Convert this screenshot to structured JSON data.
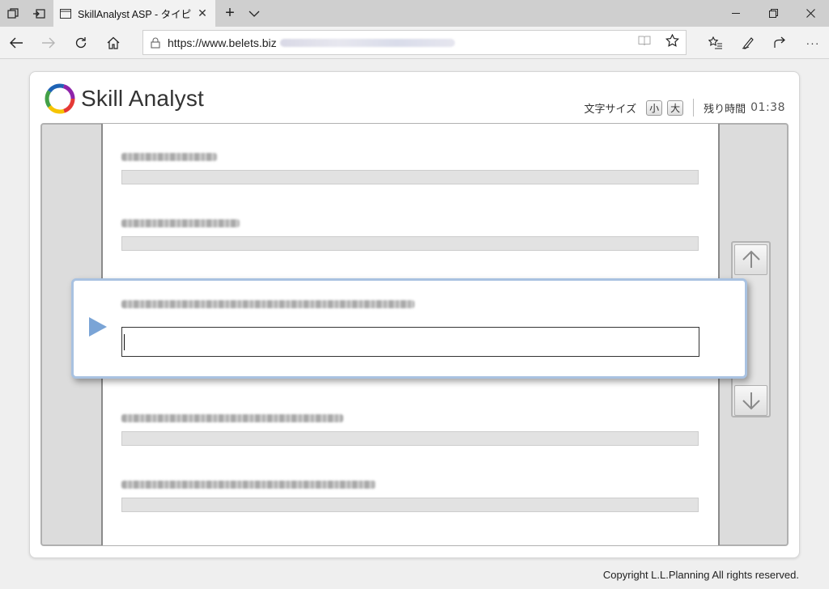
{
  "browser": {
    "tab_title": "SkillAnalyst ASP - タイピ",
    "url": "https://www.belets.biz"
  },
  "icons": {
    "tab_actions": "tab-list-icon",
    "set_aside": "set-aside-icon",
    "new_tab": "plus-icon",
    "tab_menu": "chevron-down-icon",
    "minimize": "minimize-icon",
    "restore": "restore-icon",
    "close": "close-icon",
    "back": "back-arrow-icon",
    "forward": "forward-arrow-icon",
    "refresh": "refresh-icon",
    "home": "home-icon",
    "lock": "lock-icon",
    "reading_view": "book-icon",
    "favorite": "star-icon",
    "hub": "favorites-list-icon",
    "notes": "pen-icon",
    "share": "share-icon",
    "more": "more-icon"
  },
  "app": {
    "logo_text": "Skill Analyst",
    "font_size_label": "文字サイズ",
    "font_small": "小",
    "font_large": "大",
    "time_label": "残り時間",
    "time_value": "01:38"
  },
  "answer": {
    "value": ""
  },
  "colors": {
    "active_border": "#a9c2e1",
    "play_arrow": "#7aa4d6",
    "frame_gray": "#dcdcdc"
  },
  "footer": {
    "copyright": "Copyright L.L.Planning All rights reserved."
  }
}
